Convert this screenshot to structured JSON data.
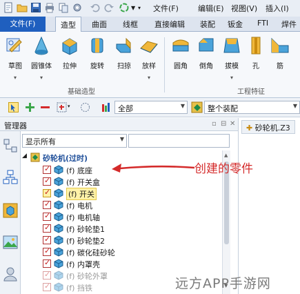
{
  "menu": {
    "items": [
      "文件(F)",
      "编辑(E)",
      "视图(V)",
      "插入(I)"
    ]
  },
  "ribbon_tabs": [
    "文件(F)",
    "造型",
    "曲面",
    "线框",
    "直接编辑",
    "装配",
    "钣金",
    "FTI",
    "焊件"
  ],
  "ribbon": {
    "basic_group": {
      "label": "基础造型",
      "buttons": [
        "草图",
        "圆锥体",
        "拉伸",
        "旋转",
        "扫掠",
        "放样"
      ]
    },
    "feature_group": {
      "label": "工程特征",
      "buttons": [
        "圆角",
        "倒角",
        "拔模",
        "孔",
        "筋"
      ]
    }
  },
  "filter": {
    "scope_value": "全部",
    "assembly_value": "整个装配"
  },
  "manager": {
    "title": "管理器",
    "show_value": "显示所有",
    "search_value": ""
  },
  "tree": {
    "root": "砂轮机(过时)",
    "items": [
      {
        "label": "(f) 底座",
        "faded": false,
        "selected": false
      },
      {
        "label": "(f) 开关盒",
        "faded": false,
        "selected": false
      },
      {
        "label": "(f) 开关",
        "faded": false,
        "selected": true
      },
      {
        "label": "(f) 电机",
        "faded": false,
        "selected": false
      },
      {
        "label": "(f) 电机轴",
        "faded": false,
        "selected": false
      },
      {
        "label": "(f) 砂轮垫1",
        "faded": false,
        "selected": false
      },
      {
        "label": "(f) 砂轮垫2",
        "faded": false,
        "selected": false
      },
      {
        "label": "(f) 碳化硅砂轮",
        "faded": false,
        "selected": false
      },
      {
        "label": "(f) 内罩壳",
        "faded": false,
        "selected": false
      },
      {
        "label": "(f) 砂轮外罩",
        "faded": true,
        "selected": false
      },
      {
        "label": "(f) 挡铁",
        "faded": true,
        "selected": false
      }
    ]
  },
  "document_tab": {
    "label": "砂轮机.Z3"
  },
  "annotation": {
    "text": "创建的零件"
  },
  "watermark": {
    "text": "远方APP手游网"
  },
  "colors": {
    "accent": "#1f5fbf",
    "annotation": "#d42a2a",
    "check": "#c41e1e",
    "selection": "#fff2a8"
  }
}
